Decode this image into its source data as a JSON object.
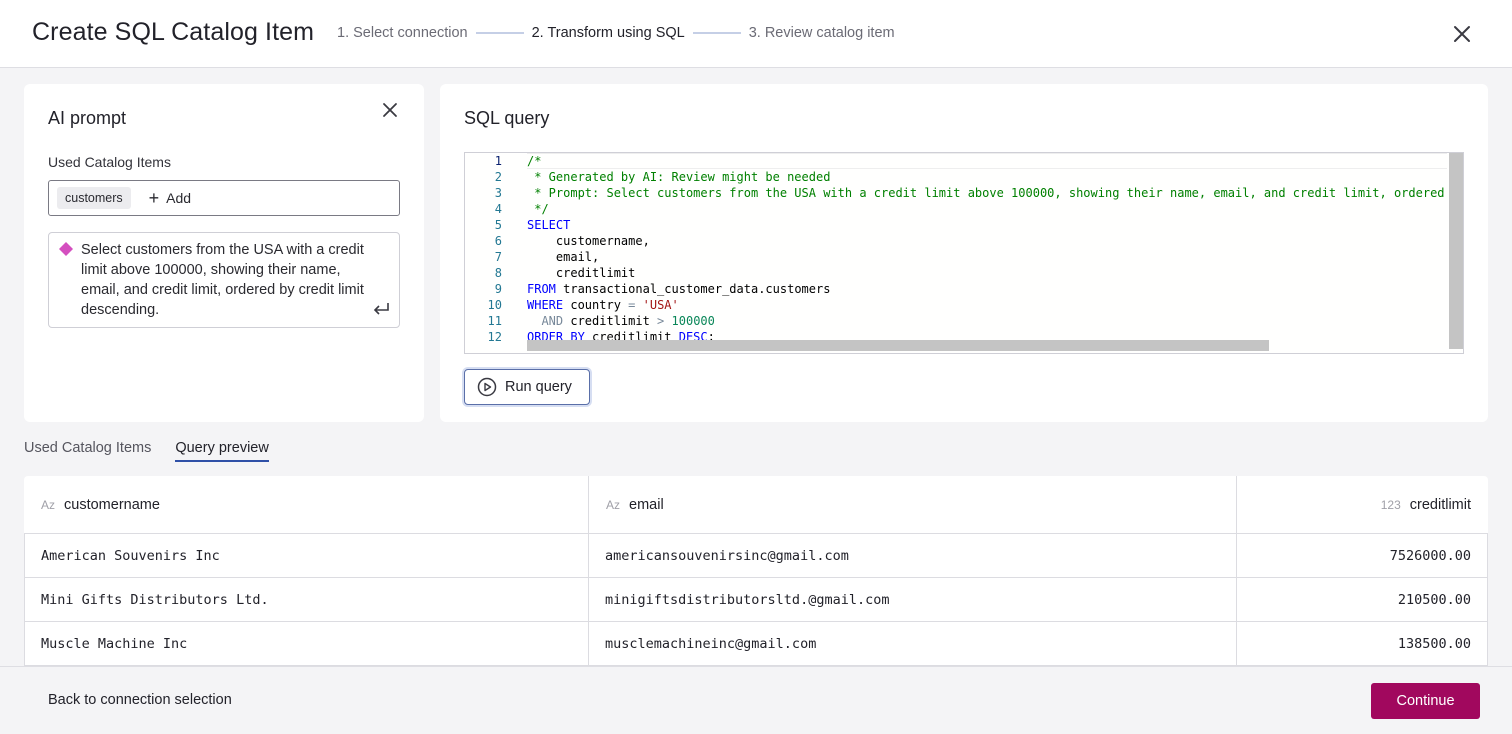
{
  "header": {
    "title": "Create SQL Catalog Item",
    "steps": [
      "1. Select connection",
      "2. Transform using SQL",
      "3. Review catalog item"
    ],
    "active_step": 2
  },
  "ai_prompt": {
    "title": "AI prompt",
    "used_label": "Used Catalog Items",
    "chip": "customers",
    "add_label": "Add",
    "prompt_text": "Select customers from the USA with a credit limit above 100000, showing their name, email, and credit limit, ordered by credit limit descending."
  },
  "sql": {
    "title": "SQL query",
    "line_numbers": [
      "1",
      "2",
      "3",
      "4",
      "5",
      "6",
      "7",
      "8",
      "9",
      "10",
      "11",
      "12"
    ],
    "lines": [
      [
        {
          "t": "/*",
          "c": "comment"
        }
      ],
      [
        {
          "t": " * Generated by AI: Review might be needed",
          "c": "comment"
        }
      ],
      [
        {
          "t": " * Prompt: Select customers from the USA with a credit limit above 100000, showing their name, email, and credit limit, ordered by",
          "c": "comment"
        }
      ],
      [
        {
          "t": " */",
          "c": "comment"
        }
      ],
      [
        {
          "t": "SELECT",
          "c": "kw"
        }
      ],
      [
        {
          "t": "    customername,",
          "c": "id"
        }
      ],
      [
        {
          "t": "    email,",
          "c": "id"
        }
      ],
      [
        {
          "t": "    creditlimit",
          "c": "id"
        }
      ],
      [
        {
          "t": "FROM",
          "c": "kw"
        },
        {
          "t": " transactional_customer_data.customers",
          "c": "id"
        }
      ],
      [
        {
          "t": "WHERE",
          "c": "kw"
        },
        {
          "t": " country ",
          "c": "id"
        },
        {
          "t": "=",
          "c": "op"
        },
        {
          "t": " ",
          "c": "id"
        },
        {
          "t": "'USA'",
          "c": "str"
        }
      ],
      [
        {
          "t": "  AND",
          "c": "op"
        },
        {
          "t": " creditlimit ",
          "c": "id"
        },
        {
          "t": ">",
          "c": "op"
        },
        {
          "t": " ",
          "c": "id"
        },
        {
          "t": "100000",
          "c": "num"
        }
      ],
      [
        {
          "t": "ORDER BY",
          "c": "kw"
        },
        {
          "t": " creditlimit ",
          "c": "id"
        },
        {
          "t": "DESC",
          "c": "kw"
        },
        {
          "t": ";",
          "c": "id"
        }
      ]
    ],
    "run_label": "Run query"
  },
  "tabs": [
    "Used Catalog Items",
    "Query preview"
  ],
  "active_tab": 1,
  "table": {
    "columns": [
      {
        "type": "Az",
        "name": "customername"
      },
      {
        "type": "Az",
        "name": "email"
      },
      {
        "type": "123",
        "name": "creditlimit"
      }
    ],
    "rows": [
      [
        "American Souvenirs Inc",
        "americansouvenirsinc@gmail.com",
        "7526000.00"
      ],
      [
        "Mini Gifts Distributors Ltd.",
        "minigiftsdistributorsltd.@gmail.com",
        "210500.00"
      ],
      [
        "Muscle Machine Inc",
        "musclemachineinc@gmail.com",
        "138500.00"
      ]
    ]
  },
  "footer": {
    "back_label": "Back to connection selection",
    "continue_label": "Continue"
  },
  "colors": {
    "accent": "#a1085e",
    "tab_underline": "#2f50a7",
    "ai_diamond": "#d44fbf"
  }
}
